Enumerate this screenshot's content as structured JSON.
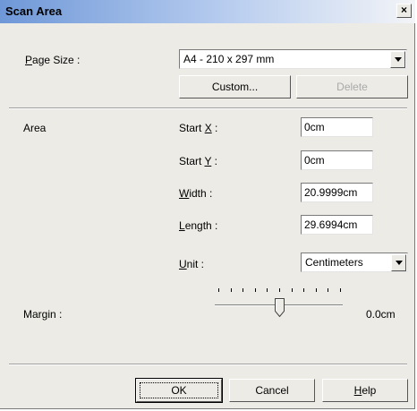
{
  "window": {
    "title": "Scan Area",
    "close_label": "×"
  },
  "page_size": {
    "label_pre": "",
    "label_mnemonic": "P",
    "label_post": "age Size :",
    "selected": "A4 - 210 x 297 mm"
  },
  "buttons": {
    "custom": "Custom...",
    "delete": "Delete",
    "ok": "OK",
    "cancel": "Cancel",
    "help_mnemonic": "H",
    "help_rest": "elp"
  },
  "area": {
    "label": "Area",
    "start_x": {
      "label_pre": "Start ",
      "mnemonic": "X",
      "label_post": " :",
      "value": "0cm"
    },
    "start_y": {
      "label_pre": "Start ",
      "mnemonic": "Y",
      "label_post": " :",
      "value": "0cm"
    },
    "width": {
      "label_pre": "",
      "mnemonic": "W",
      "label_post": "idth :",
      "value": "20.9999cm"
    },
    "length": {
      "label_pre": "",
      "mnemonic": "L",
      "label_post": "ength :",
      "value": "29.6994cm"
    },
    "unit": {
      "label_pre": "",
      "mnemonic": "U",
      "label_post": "nit :",
      "selected": "Centimeters"
    }
  },
  "margin": {
    "label_pre": "Mar",
    "mnemonic": "g",
    "label_post": "in :",
    "value_text": "0.0cm",
    "slider_ticks": 11,
    "slider_position_fraction": 0.5
  }
}
